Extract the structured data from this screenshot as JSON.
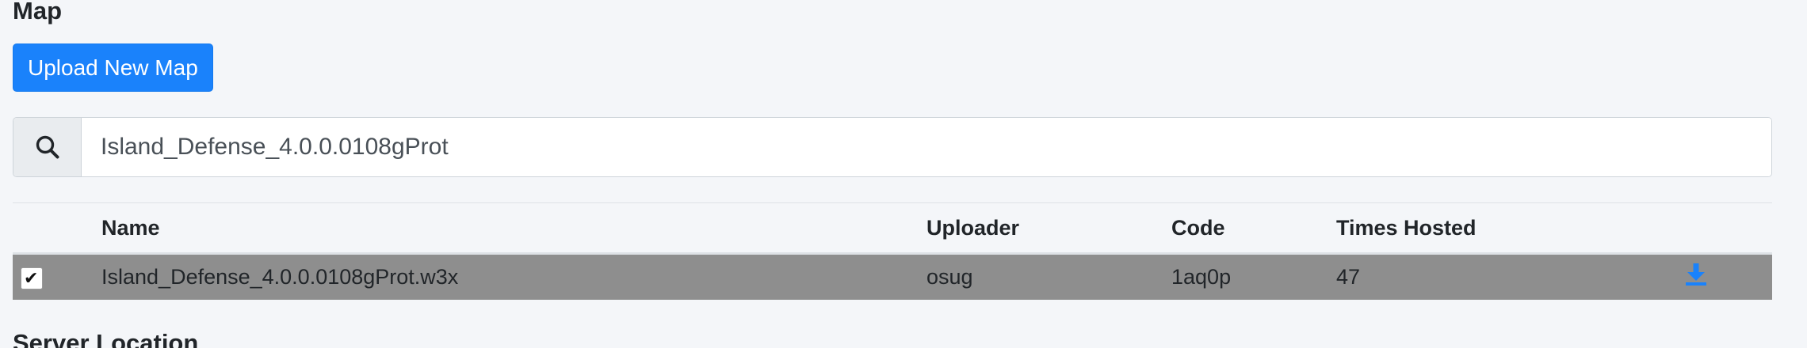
{
  "map_section": {
    "title": "Map",
    "upload_button_label": "Upload New Map"
  },
  "search": {
    "value": "Island_Defense_4.0.0.0108gProt",
    "icon": "search-icon"
  },
  "table": {
    "headers": [
      "",
      "Name",
      "Uploader",
      "Code",
      "Times Hosted",
      ""
    ],
    "rows": [
      {
        "checked": true,
        "name": "Island_Defense_4.0.0.0108gProt.w3x",
        "uploader": "osug",
        "code": "1aq0p",
        "times_hosted": "47",
        "action_icon": "download-icon"
      }
    ]
  },
  "server_section": {
    "title": "Server Location"
  },
  "colors": {
    "accent": "#1a82fb",
    "selected_row": "#8e8e8e",
    "page_background": "#f4f6f9"
  }
}
